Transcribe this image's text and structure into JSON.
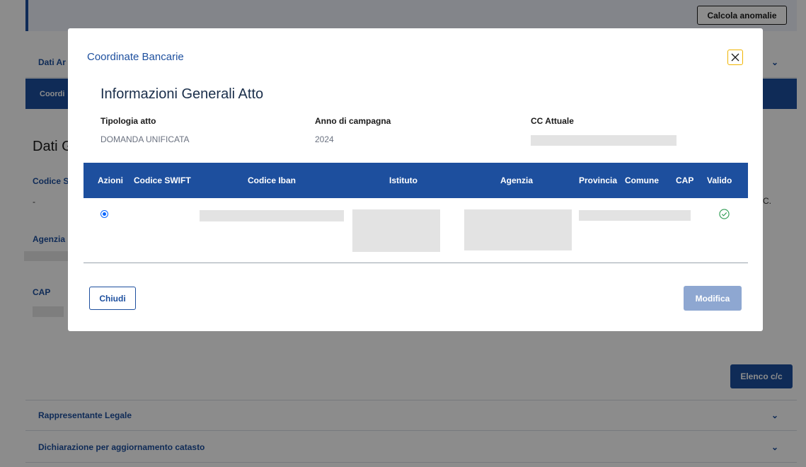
{
  "background": {
    "calcola_label": "Calcola anomalie",
    "dati_accordion_label": "Dati Ar",
    "active_accordion_label": "Coordi",
    "heading": "Dati G",
    "codice_label": "Codice S",
    "codice_value": "-",
    "agenzia_label": "Agenzia",
    "cap_label": "CAP",
    "right_fragment": "C.",
    "elenco_label": "Elenco c/c",
    "rappresentante_label": "Rappresentante Legale",
    "dichiarazione_label": "Dichiarazione per aggiornamento catasto"
  },
  "modal": {
    "title": "Coordinate Bancarie",
    "section_title": "Informazioni Generali Atto",
    "info": {
      "tipologia_label": "Tipologia atto",
      "tipologia_value": "DOMANDA UNIFICATA",
      "anno_label": "Anno di campagna",
      "anno_value": "2024",
      "cc_label": "CC Attuale"
    },
    "table": {
      "headers": [
        "Azioni",
        "Codice SWIFT",
        "Codice Iban",
        "Istituto",
        "Agenzia",
        "Provincia",
        "Comune",
        "CAP",
        "Valido"
      ]
    },
    "chiudi_label": "Chiudi",
    "modifica_label": "Modifica"
  },
  "colors": {
    "primary": "#1d4f9e",
    "disabled_button": "#8ea7d1",
    "close_border": "#f0b400",
    "valid_green": "#2e9b52"
  },
  "icons": [
    "close-icon",
    "chevron-down-icon",
    "check-circle-icon",
    "radio-selected-icon"
  ]
}
